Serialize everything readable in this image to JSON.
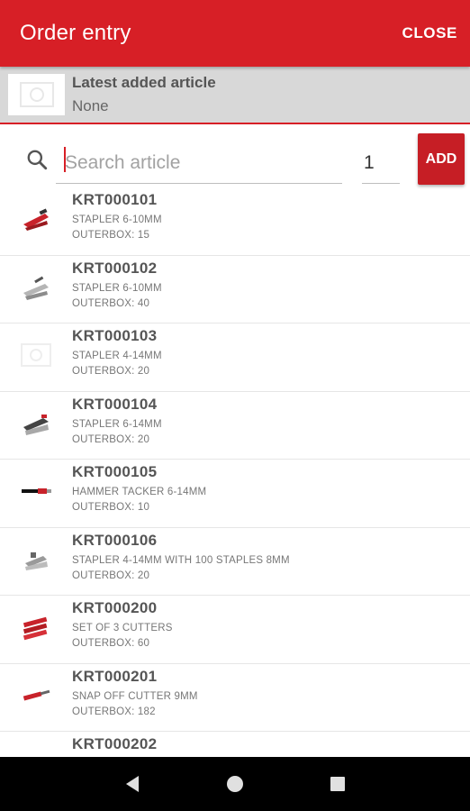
{
  "appbar": {
    "title": "Order entry",
    "close_label": "CLOSE",
    "color": "#d71f26"
  },
  "latest": {
    "label": "Latest added article",
    "value": "None"
  },
  "search": {
    "placeholder": "Search article",
    "quantity": "1",
    "add_label": "ADD"
  },
  "articles": [
    {
      "code": "KRT000101",
      "desc": "STAPLER 6-10MM",
      "outer": "OUTERBOX: 15",
      "icon": "red-stapler-icon"
    },
    {
      "code": "KRT000102",
      "desc": "STAPLER 6-10MM",
      "outer": "OUTERBOX: 40",
      "icon": "grey-stapler-icon"
    },
    {
      "code": "KRT000103",
      "desc": "STAPLER 4-14MM",
      "outer": "OUTERBOX: 20",
      "icon": "placeholder-image-icon"
    },
    {
      "code": "KRT000104",
      "desc": "STAPLER 6-14MM",
      "outer": "OUTERBOX: 20",
      "icon": "stapler-icon"
    },
    {
      "code": "KRT000105",
      "desc": "HAMMER TACKER 6-14MM",
      "outer": "OUTERBOX: 10",
      "icon": "hammer-tacker-icon"
    },
    {
      "code": "KRT000106",
      "desc": "STAPLER 4-14MM WITH 100 STAPLES 8MM",
      "outer": "OUTERBOX: 20",
      "icon": "stapler-icon"
    },
    {
      "code": "KRT000200",
      "desc": "SET OF 3 CUTTERS",
      "outer": "OUTERBOX: 60",
      "icon": "cutters-set-icon"
    },
    {
      "code": "KRT000201",
      "desc": "SNAP OFF CUTTER 9MM",
      "outer": "OUTERBOX: 182",
      "icon": "snap-off-cutter-icon"
    },
    {
      "code": "KRT000202",
      "desc": "",
      "outer": "",
      "icon": "cutter-icon"
    }
  ]
}
